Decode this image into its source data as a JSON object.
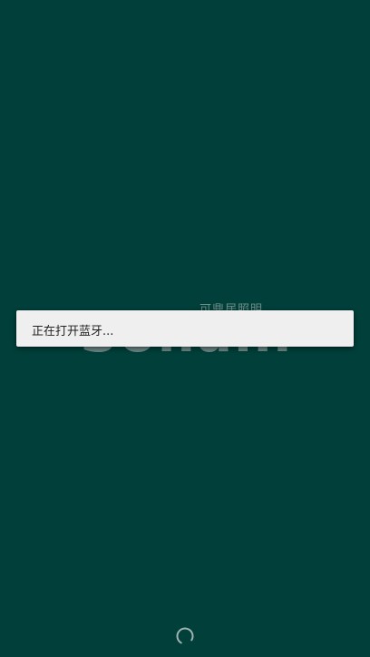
{
  "splash": {
    "tagline": "可鼎居照明",
    "logo_text": "Sonani"
  },
  "dialog": {
    "message": "正在打开蓝牙..."
  },
  "colors": {
    "background": "#013f3a",
    "dialog_background": "#efefef",
    "spinner": "#9fb3b0"
  },
  "icons": {
    "spinner": "loading-spinner-icon"
  }
}
